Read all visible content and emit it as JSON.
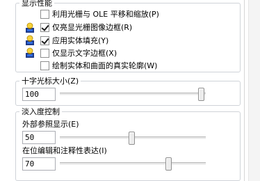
{
  "display": {
    "title": "显示性能",
    "options": [
      {
        "label": "利用光栅与 OLE 平移和缩放(P)",
        "checked": false,
        "has_icon": false
      },
      {
        "label": "仅亮显光栅图像边框(R)",
        "checked": true,
        "has_icon": true
      },
      {
        "label": "应用实体填充(Y)",
        "checked": true,
        "has_icon": true
      },
      {
        "label": "仅显示文字边框(X)",
        "checked": false,
        "has_icon": true
      },
      {
        "label": "绘制实体和曲面的真实轮廓(W)",
        "checked": false,
        "has_icon": false
      }
    ]
  },
  "crosshair": {
    "title": "十字光标大小(Z)",
    "value": "100",
    "level_percent": 100
  },
  "fade": {
    "title": "淡入度控制",
    "xref": {
      "label": "外部参照显示(E)",
      "value": "50",
      "level_percent": 50
    },
    "inplace": {
      "label": "在位编辑和注释性表达(I)",
      "value": "70",
      "level_percent": 70
    }
  },
  "icons": {
    "option_icon": "lamp-icon"
  }
}
